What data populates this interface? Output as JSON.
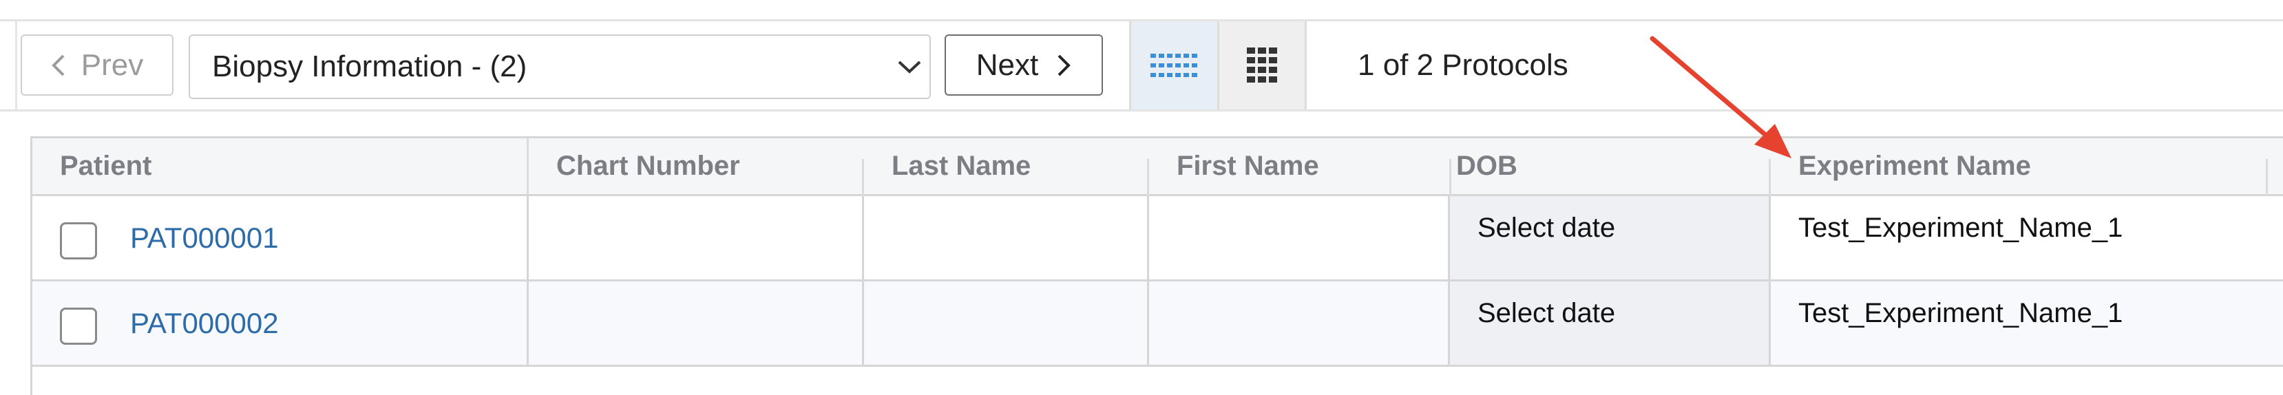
{
  "toolbar": {
    "prev_label": "Prev",
    "next_label": "Next",
    "protocol_select_value": "Biopsy Information - (2)",
    "protocol_count": "1 of 2 Protocols",
    "view_list_icon": "list-view-icon",
    "view_grid_icon": "grid-view-icon"
  },
  "table": {
    "columns": [
      "Patient",
      "Chart Number",
      "Last Name",
      "First Name",
      "DOB",
      "Experiment Name"
    ],
    "rows": [
      {
        "patient": "PAT000001",
        "chart_number": "",
        "last_name": "",
        "first_name": "",
        "dob": "Select date",
        "experiment_name": "Test_Experiment_Name_1"
      },
      {
        "patient": "PAT000002",
        "chart_number": "",
        "last_name": "",
        "first_name": "",
        "dob": "Select date",
        "experiment_name": "Test_Experiment_Name_1"
      }
    ]
  },
  "colors": {
    "link": "#2d6ca8",
    "header_text": "#7b7f84",
    "annotation_arrow": "#e5432f",
    "active_view_bg": "#e8eef5"
  }
}
